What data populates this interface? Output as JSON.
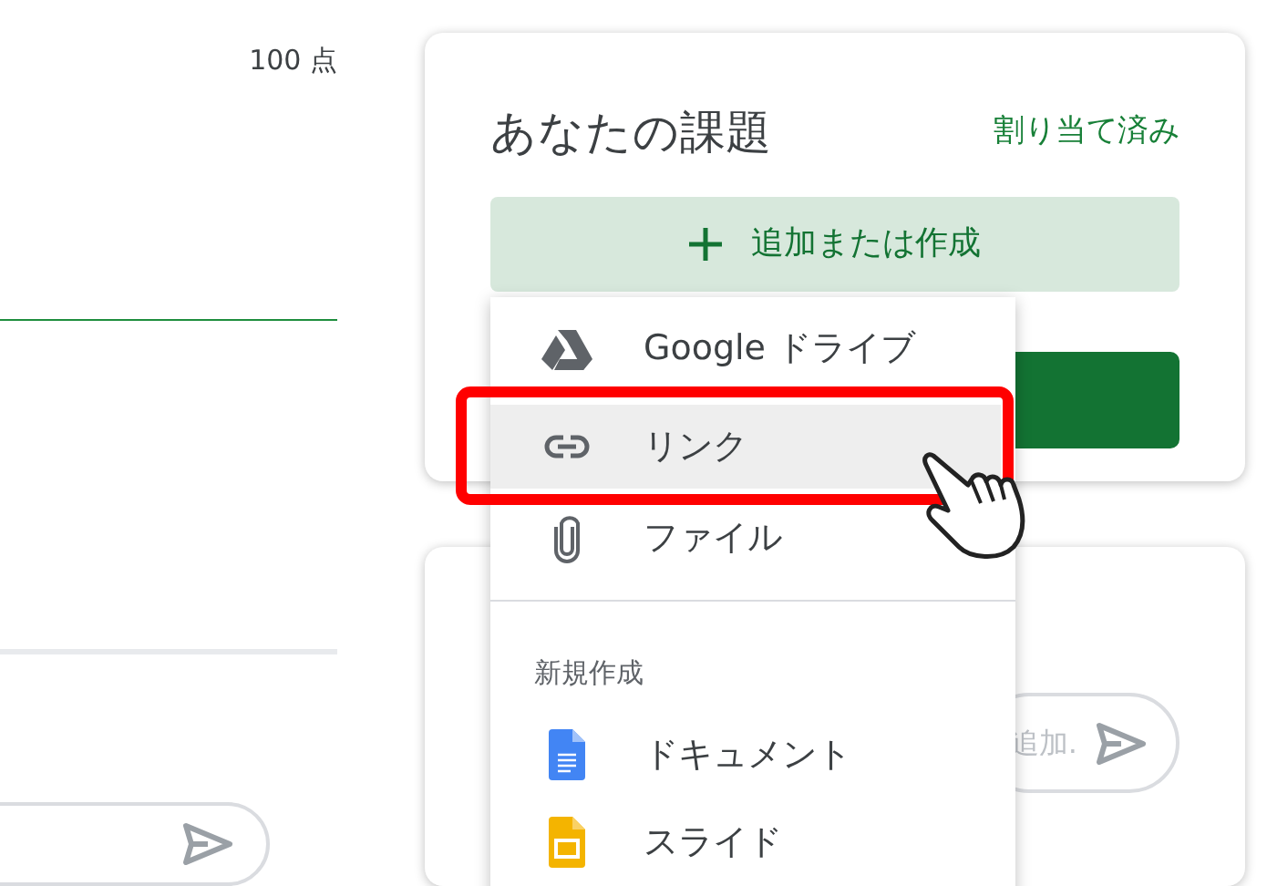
{
  "left": {
    "points": "100 点"
  },
  "assignment_card": {
    "title": "あなたの課題",
    "status": "割り当て済み",
    "add_button": {
      "label": "追加または作成"
    }
  },
  "add_menu": {
    "items": [
      {
        "kind": "drive",
        "label": "Google ドライブ",
        "selected": false
      },
      {
        "kind": "link",
        "label": "リンク",
        "selected": true
      },
      {
        "kind": "file",
        "label": "ファイル",
        "selected": false
      }
    ],
    "section_header": "新規作成",
    "create_items": [
      {
        "kind": "document",
        "label": "ドキュメント",
        "selected": false
      },
      {
        "kind": "slides",
        "label": "スライド",
        "selected": false
      }
    ]
  },
  "comment_card": {
    "placeholder": "追加."
  }
}
